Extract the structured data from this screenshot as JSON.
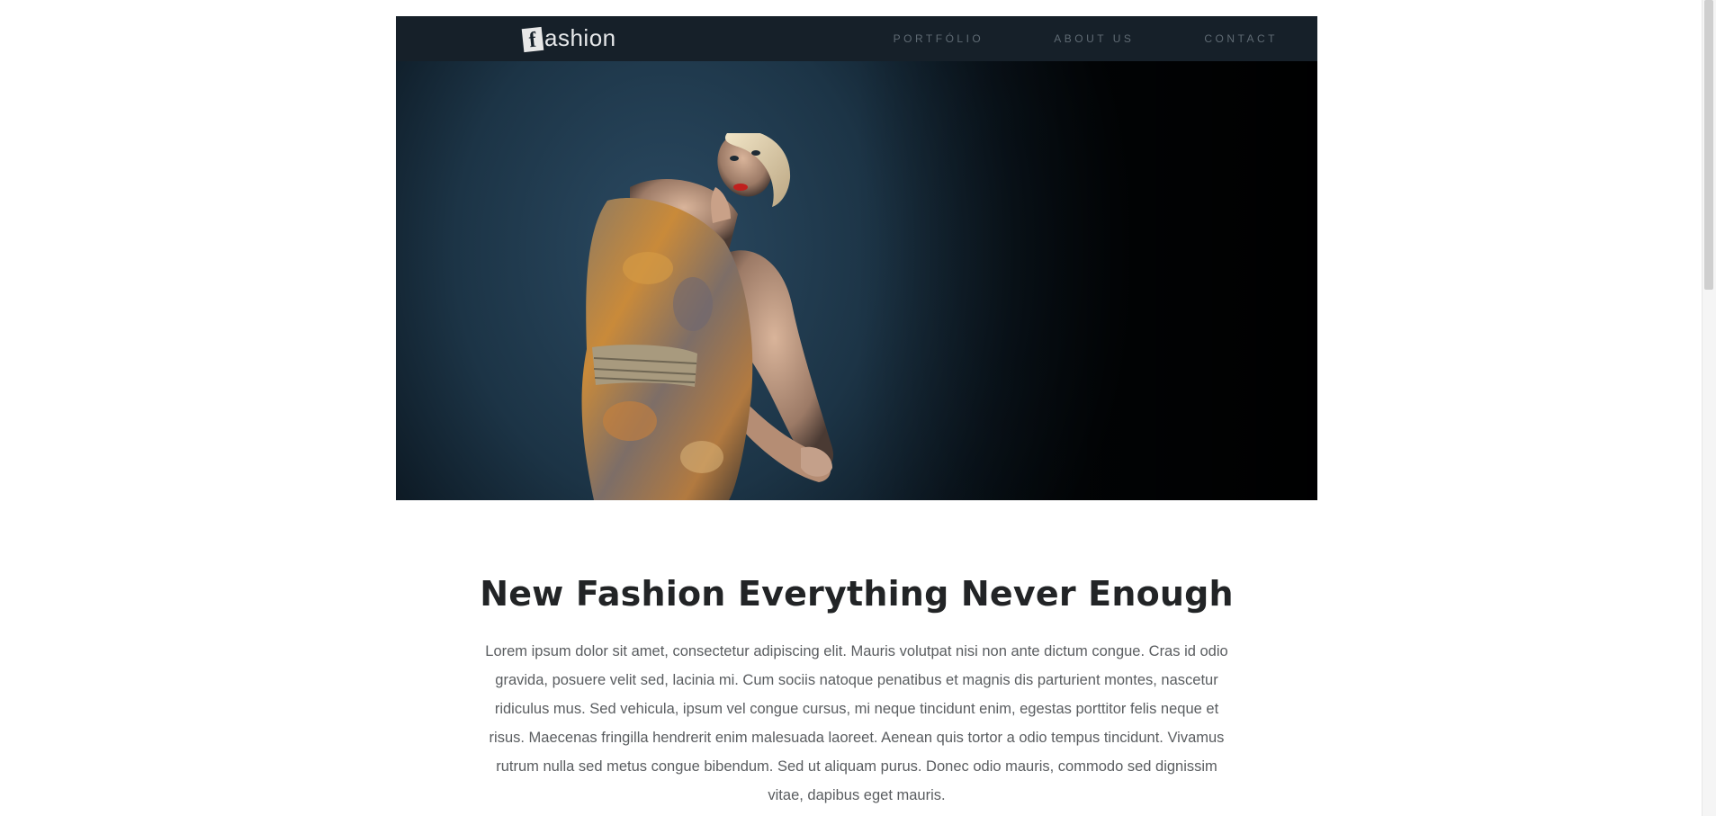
{
  "header": {
    "logo_initial": "f",
    "logo_rest": "ashion",
    "nav": [
      "PORTFÓLIO",
      "ABOUT US",
      "CONTACT"
    ]
  },
  "hero": {
    "image_subject": "fashion-model-in-patterned-dress"
  },
  "article": {
    "title": "New Fashion Everything Never Enough",
    "body": "Lorem ipsum dolor sit amet, consectetur adipiscing elit. Mauris volutpat nisi non ante dictum congue. Cras id odio gravida, posuere velit sed, lacinia mi. Cum sociis natoque penatibus et magnis dis parturient montes, nascetur ridiculus mus. Sed vehicula, ipsum vel congue cursus, mi neque tincidunt enim, egestas porttitor felis neque et risus. Maecenas fringilla hendrerit enim malesuada laoreet. Aenean quis tortor a odio tempus tincidunt. Vivamus rutrum nulla sed metus congue bibendum. Sed ut aliquam purus. Donec odio mauris, commodo sed dignissim vitae, dapibus eget mauris."
  },
  "colors": {
    "navbar_bg": "#162029",
    "nav_text": "#5f6a73",
    "title_text": "#222426",
    "body_text": "#5a5d60"
  }
}
